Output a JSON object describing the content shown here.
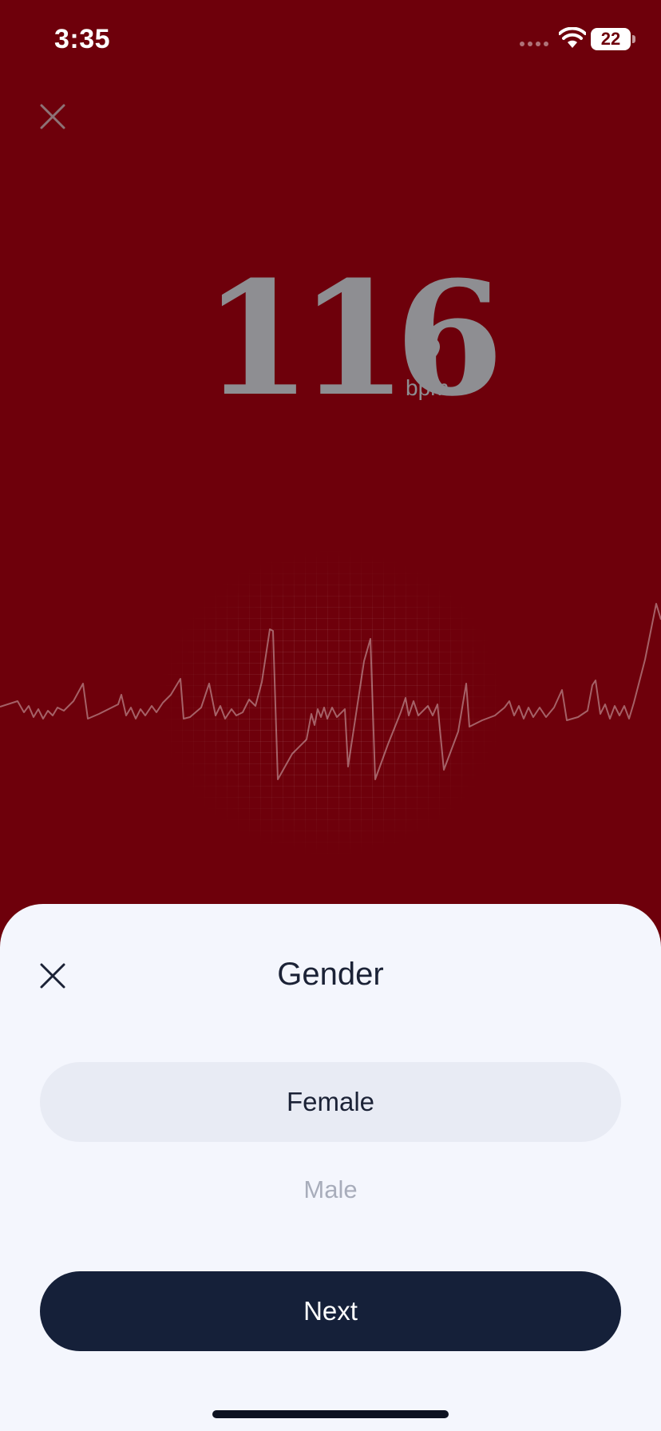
{
  "status_bar": {
    "time": "3:35",
    "battery": "22"
  },
  "heart_rate": {
    "value": "116",
    "unit": "bpm"
  },
  "sheet": {
    "title": "Gender",
    "options": [
      {
        "label": "Female",
        "selected": true
      },
      {
        "label": "Male",
        "selected": false
      }
    ],
    "next_label": "Next"
  },
  "icons": {
    "top_close": "close-icon",
    "sheet_close": "close-icon",
    "heart": "heart-icon",
    "wifi": "wifi-icon"
  },
  "colors": {
    "background": "#6e000b",
    "sheet": "#f4f6fd",
    "primary": "#152039",
    "selected_option": "#e8ebf4",
    "muted_text": "#a8adbb"
  }
}
